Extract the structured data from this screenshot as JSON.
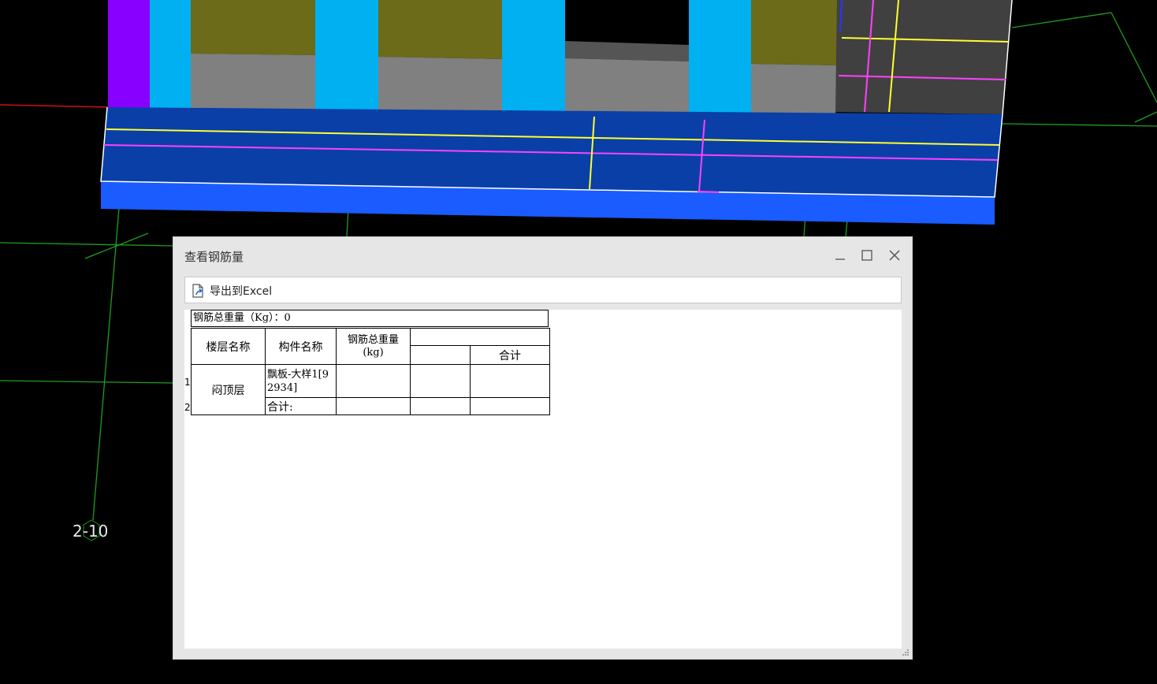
{
  "viewport": {
    "axis_label": "2-10",
    "colors": {
      "background": "#000000",
      "slab_top": "#0a3fa8",
      "slab_front": "#1a5cff",
      "column": "#00b0f0",
      "wall_olive": "#6b6b1a",
      "wall_gray": "#808080",
      "purple": "#8800ff",
      "rebar_yellow": "#ffff30",
      "rebar_magenta": "#ff40ff",
      "grid_green": "#1f9e1f",
      "axis_red": "#d01010"
    }
  },
  "dialog": {
    "title": "查看钢筋量",
    "window_buttons": {
      "minimize": "minimize-icon",
      "maximize": "maximize-icon",
      "close": "close-icon"
    },
    "toolbar": {
      "export_label": "导出到Excel",
      "export_icon": "export-file-icon"
    },
    "report": {
      "title": "钢筋总重量（Kg）：0",
      "headers": {
        "floor": "楼层名称",
        "component": "构件名称",
        "total_weight": "钢筋总重量(kg)",
        "subtotal": "合计"
      },
      "row_numbers": [
        "1",
        "2"
      ],
      "rows": [
        {
          "floor": "闷顶层",
          "component": "飘板-大样1[92934]"
        },
        {
          "component": "合计:"
        }
      ]
    }
  }
}
